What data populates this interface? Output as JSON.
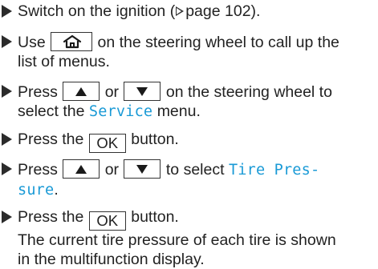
{
  "steps": [
    {
      "pre": "Switch on the ignition (",
      "page_ref": "page 102",
      "post": ")."
    },
    {
      "use": "Use",
      "home_key": "home-icon",
      "line1_rest": "on the steering wheel to call up the",
      "line2": "list of menus."
    },
    {
      "press": "Press",
      "up_key": "up-arrow-icon",
      "or": "or",
      "down_key": "down-arrow-icon",
      "line1_rest": "on the steering wheel to",
      "line2_pre": "select the",
      "menu_name": "Service",
      "line2_post": "menu."
    },
    {
      "pre": "Press the",
      "key": "OK",
      "post": "button."
    },
    {
      "press": "Press",
      "or": "or",
      "to_select": "to select",
      "menu_line1": "Tire Pres-",
      "menu_line2": "sure",
      "end": "."
    },
    {
      "pre": "Press the",
      "key": "OK",
      "post": "button.",
      "result_line1": "The current tire pressure of each tire is shown",
      "result_line2": "in the multifunction display."
    }
  ]
}
